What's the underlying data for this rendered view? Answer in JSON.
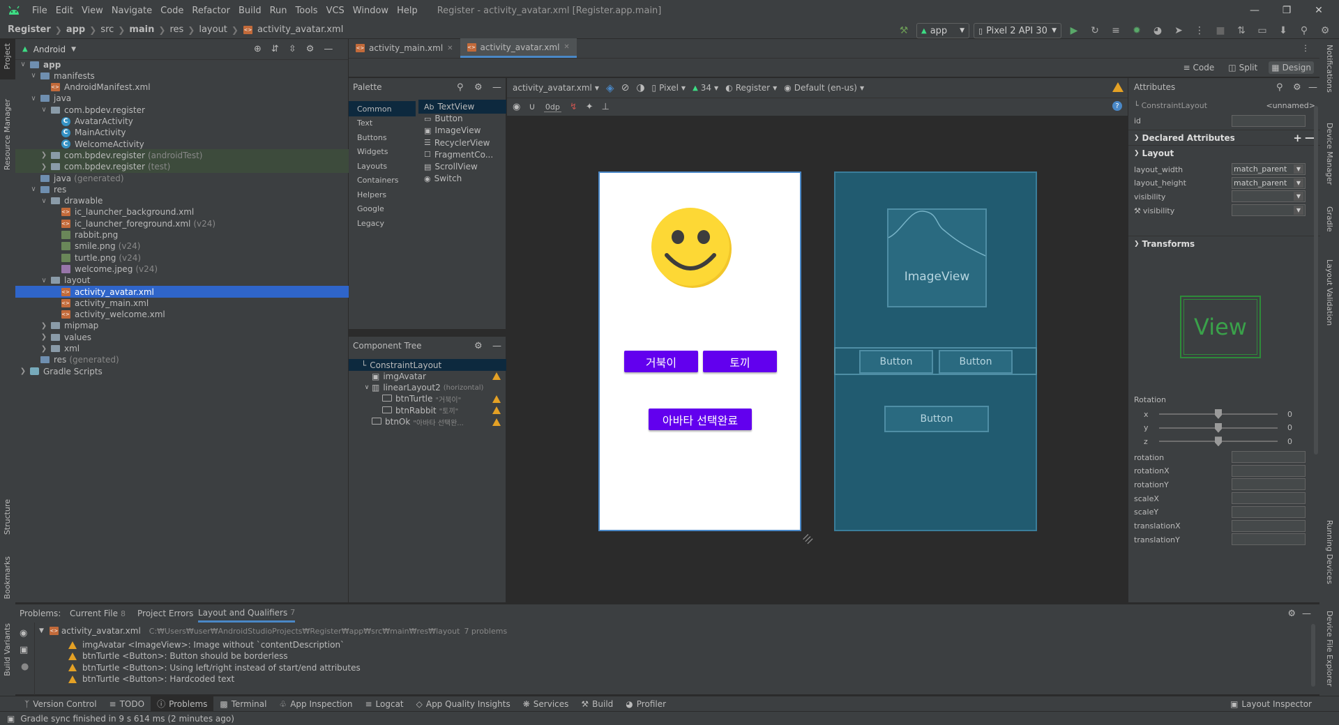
{
  "menu": {
    "items": [
      "File",
      "Edit",
      "View",
      "Navigate",
      "Code",
      "Refactor",
      "Build",
      "Run",
      "Tools",
      "VCS",
      "Window",
      "Help"
    ],
    "window_title": "Register - activity_avatar.xml [Register.app.main]"
  },
  "nav": {
    "crumbs": [
      "Register",
      "app",
      "src",
      "main",
      "res",
      "layout",
      "activity_avatar.xml"
    ],
    "run_config": "app",
    "device": "Pixel 2 API 30"
  },
  "left_strip": {
    "project": "Project",
    "resource_manager": "Resource Manager",
    "structure": "Structure",
    "bookmarks": "Bookmarks",
    "build_variants": "Build Variants"
  },
  "right_strip": {
    "notifications": "Notifications",
    "device_manager": "Device Manager",
    "gradle": "Gradle",
    "layout_validation": "Layout Validation",
    "running_devices": "Running Devices",
    "device_file_explorer": "Device File Explorer"
  },
  "project": {
    "view_mode": "Android",
    "tree": [
      {
        "label": "app",
        "dim": "",
        "icon": "folder",
        "depth": 0,
        "arrow": "v"
      },
      {
        "label": "manifests",
        "dim": "",
        "icon": "folder",
        "depth": 1,
        "arrow": "v"
      },
      {
        "label": "AndroidManifest.xml",
        "dim": "",
        "icon": "xml",
        "depth": 2,
        "arrow": ""
      },
      {
        "label": "java",
        "dim": "",
        "icon": "folder",
        "depth": 1,
        "arrow": "v"
      },
      {
        "label": "com.bpdev.register",
        "dim": "",
        "icon": "folder",
        "depth": 2,
        "arrow": "v"
      },
      {
        "label": "AvatarActivity",
        "dim": "",
        "icon": "class",
        "depth": 3,
        "arrow": ""
      },
      {
        "label": "MainActivity",
        "dim": "",
        "icon": "class",
        "depth": 3,
        "arrow": ""
      },
      {
        "label": "WelcomeActivity",
        "dim": "",
        "icon": "class",
        "depth": 3,
        "arrow": ""
      },
      {
        "label": "com.bpdev.register",
        "dim": "(androidTest)",
        "icon": "folder",
        "depth": 2,
        "arrow": ">",
        "hl": "green"
      },
      {
        "label": "com.bpdev.register",
        "dim": "(test)",
        "icon": "folder",
        "depth": 2,
        "arrow": ">",
        "hl": "green"
      },
      {
        "label": "java",
        "dim": "(generated)",
        "icon": "folder",
        "depth": 1,
        "arrow": ""
      },
      {
        "label": "res",
        "dim": "",
        "icon": "folder",
        "depth": 1,
        "arrow": "v"
      },
      {
        "label": "drawable",
        "dim": "",
        "icon": "folder",
        "depth": 2,
        "arrow": "v"
      },
      {
        "label": "ic_launcher_background.xml",
        "dim": "",
        "icon": "xml",
        "depth": 3,
        "arrow": ""
      },
      {
        "label": "ic_launcher_foreground.xml",
        "dim": "(v24)",
        "icon": "xml",
        "depth": 3,
        "arrow": ""
      },
      {
        "label": "rabbit.png",
        "dim": "",
        "icon": "png",
        "depth": 3,
        "arrow": ""
      },
      {
        "label": "smile.png",
        "dim": "(v24)",
        "icon": "png",
        "depth": 3,
        "arrow": ""
      },
      {
        "label": "turtle.png",
        "dim": "(v24)",
        "icon": "png",
        "depth": 3,
        "arrow": ""
      },
      {
        "label": "welcome.jpeg",
        "dim": "(v24)",
        "icon": "jpg",
        "depth": 3,
        "arrow": ""
      },
      {
        "label": "layout",
        "dim": "",
        "icon": "folder",
        "depth": 2,
        "arrow": "v"
      },
      {
        "label": "activity_avatar.xml",
        "dim": "",
        "icon": "xml",
        "depth": 3,
        "arrow": "",
        "hl": "selected"
      },
      {
        "label": "activity_main.xml",
        "dim": "",
        "icon": "xml",
        "depth": 3,
        "arrow": ""
      },
      {
        "label": "activity_welcome.xml",
        "dim": "",
        "icon": "xml",
        "depth": 3,
        "arrow": ""
      },
      {
        "label": "mipmap",
        "dim": "",
        "icon": "folder",
        "depth": 2,
        "arrow": ">"
      },
      {
        "label": "values",
        "dim": "",
        "icon": "folder",
        "depth": 2,
        "arrow": ">"
      },
      {
        "label": "xml",
        "dim": "",
        "icon": "folder",
        "depth": 2,
        "arrow": ">"
      },
      {
        "label": "res",
        "dim": "(generated)",
        "icon": "folder",
        "depth": 1,
        "arrow": ""
      },
      {
        "label": "Gradle Scripts",
        "dim": "",
        "icon": "gradle",
        "depth": 0,
        "arrow": ">"
      }
    ]
  },
  "editor_tabs": [
    {
      "label": "activity_main.xml",
      "active": false
    },
    {
      "label": "activity_avatar.xml",
      "active": true
    }
  ],
  "view_modes": {
    "code": "Code",
    "split": "Split",
    "design": "Design"
  },
  "palette": {
    "title": "Palette",
    "categories": [
      "Common",
      "Text",
      "Buttons",
      "Widgets",
      "Layouts",
      "Containers",
      "Helpers",
      "Google",
      "Legacy"
    ],
    "items": [
      {
        "icon": "Ab",
        "label": "TextView"
      },
      {
        "icon": "btn",
        "label": "Button"
      },
      {
        "icon": "img",
        "label": "ImageView"
      },
      {
        "icon": "list",
        "label": "RecyclerView"
      },
      {
        "icon": "frag",
        "label": "FragmentCo..."
      },
      {
        "icon": "scroll",
        "label": "ScrollView"
      },
      {
        "icon": "sw",
        "label": "Switch"
      }
    ]
  },
  "component_tree": {
    "title": "Component Tree",
    "rows": [
      {
        "label": "ConstraintLayout",
        "sub": "",
        "depth": 0,
        "warn": false
      },
      {
        "label": "imgAvatar",
        "sub": "",
        "depth": 1,
        "warn": true
      },
      {
        "label": "linearLayout2",
        "sub": "(horizontal)",
        "depth": 1,
        "warn": false
      },
      {
        "label": "btnTurtle",
        "sub": "\"거북이\"",
        "depth": 2,
        "warn": true
      },
      {
        "label": "btnRabbit",
        "sub": "\"토끼\"",
        "depth": 2,
        "warn": true
      },
      {
        "label": "btnOk",
        "sub": "\"아바타 선택완...",
        "depth": 1,
        "warn": true
      }
    ]
  },
  "design_toolbar": {
    "file": "activity_avatar.xml",
    "device": "Pixel",
    "api": "34",
    "theme": "Register",
    "locale": "Default (en-us)",
    "margin": "0dp"
  },
  "preview": {
    "btn_turtle": "거북이",
    "btn_rabbit": "토끼",
    "btn_ok": "아바타 선택완료"
  },
  "blueprint": {
    "imageview": "ImageView",
    "button": "Button"
  },
  "attributes": {
    "title": "Attributes",
    "class": "ConstraintLayout",
    "unnamed": "<unnamed>",
    "id_label": "id",
    "declared": "Declared Attributes",
    "layout_section": "Layout",
    "layout_rows": [
      {
        "label": "layout_width",
        "value": "match_parent"
      },
      {
        "label": "layout_height",
        "value": "match_parent"
      },
      {
        "label": "visibility",
        "value": ""
      },
      {
        "label": "visibility",
        "value": ""
      }
    ],
    "transforms": "Transforms",
    "view_label": "View",
    "rotation_label": "Rotation",
    "axes": [
      {
        "axis": "x",
        "value": "0"
      },
      {
        "axis": "y",
        "value": "0"
      },
      {
        "axis": "z",
        "value": "0"
      }
    ],
    "transform_rows": [
      "rotation",
      "rotationX",
      "rotationY",
      "scaleX",
      "scaleY",
      "translationX",
      "translationY"
    ]
  },
  "problems": {
    "label": "Problems:",
    "tabs": [
      {
        "label": "Current File",
        "count": "8"
      },
      {
        "label": "Project Errors",
        "count": ""
      },
      {
        "label": "Layout and Qualifiers",
        "count": "7"
      }
    ],
    "file": "activity_avatar.xml",
    "path": "C:₩Users₩user₩AndroidStudioProjects₩Register₩app₩src₩main₩res₩layout",
    "summary": "7 problems",
    "items": [
      "imgAvatar <ImageView>: Image without `contentDescription`",
      "btnTurtle <Button>: Button should be borderless",
      "btnTurtle <Button>: Using left/right instead of start/end attributes",
      "btnTurtle <Button>: Hardcoded text"
    ]
  },
  "tool_buttons": [
    "Version Control",
    "TODO",
    "Problems",
    "Terminal",
    "App Inspection",
    "Logcat",
    "App Quality Insights",
    "Services",
    "Build",
    "Profiler"
  ],
  "layout_inspector": "Layout Inspector",
  "status": "Gradle sync finished in 9 s 614 ms (2 minutes ago)",
  "colors": {
    "accent": "#4a88c7",
    "button_purple": "#6200ee",
    "blueprint": "#215b70",
    "warning": "#e4a125"
  }
}
